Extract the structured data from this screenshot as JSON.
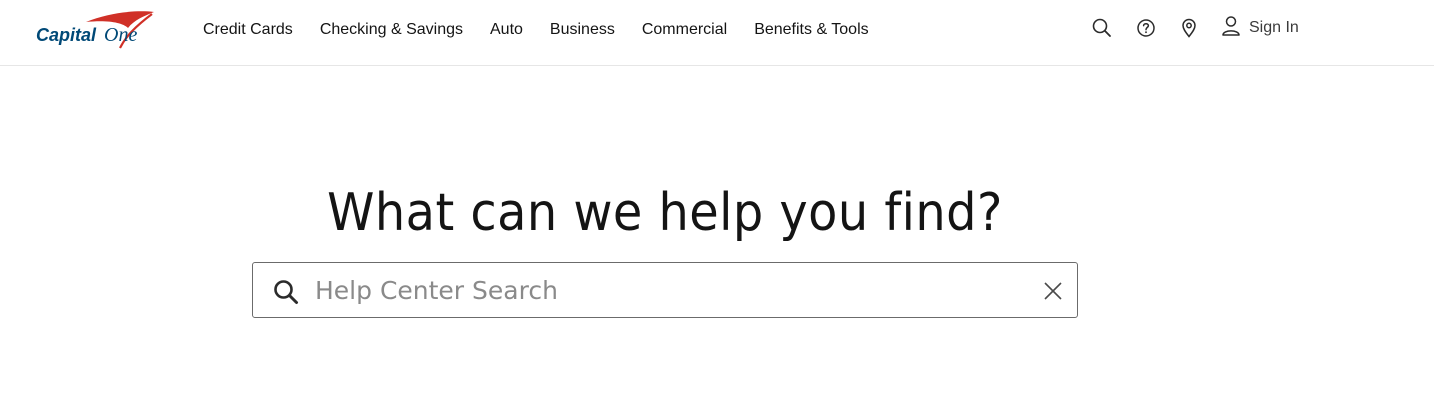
{
  "brand": {
    "logo_text_main": "Capital",
    "logo_text_accent": "One",
    "logo_color": "#004977",
    "swoosh_color": "#d03027"
  },
  "nav": {
    "items": [
      {
        "label": "Credit Cards"
      },
      {
        "label": "Checking & Savings"
      },
      {
        "label": "Auto"
      },
      {
        "label": "Business"
      },
      {
        "label": "Commercial"
      },
      {
        "label": "Benefits & Tools"
      }
    ]
  },
  "utility": {
    "search_icon": "search-icon",
    "help_icon": "question-circle-icon",
    "location_icon": "map-pin-icon",
    "user_icon": "user-icon",
    "signin_label": "Sign In"
  },
  "hero": {
    "title": "What can we help you find?"
  },
  "search": {
    "placeholder": "Help Center Search",
    "value": "",
    "search_icon": "search-icon",
    "clear_icon": "close-icon"
  }
}
